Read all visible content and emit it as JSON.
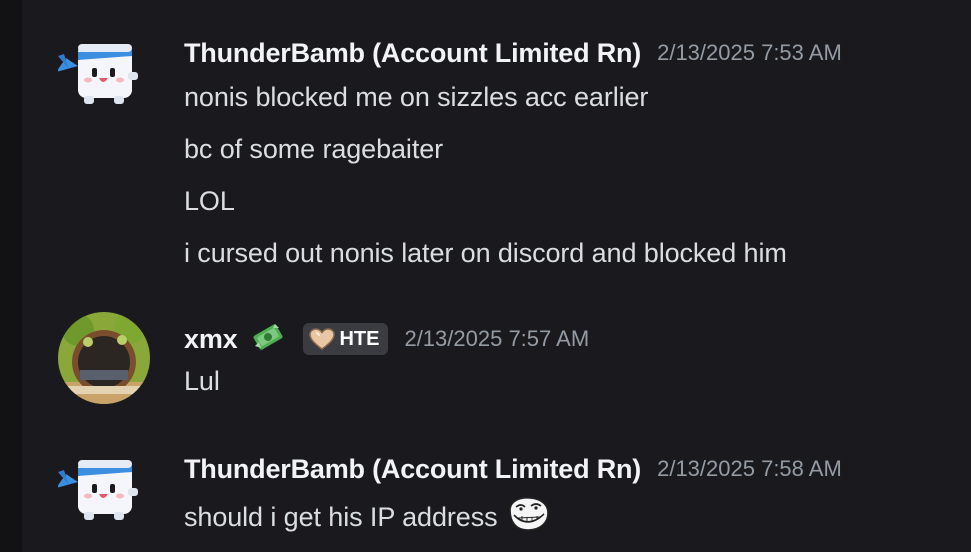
{
  "colors": {
    "background": "#1a1a1e",
    "username": "#f2f3f5",
    "timestamp": "#949ba4",
    "message_text": "#dbdee1",
    "badge_bg": "#3a3c42"
  },
  "messages": [
    {
      "author": "ThunderBamb (Account Limited Rn)",
      "timestamp": "2/13/2025 7:53 AM",
      "avatar_icon": "cube-headband-avatar-icon",
      "lines": [
        "nonis blocked me on sizzles acc earlier",
        "bc of some ragebaiter",
        "LOL",
        "i cursed out nonis later on discord and blocked him"
      ]
    },
    {
      "author": "xmx",
      "author_emoji_icon": "money-cash-icon",
      "badge": {
        "icon": "heart-icon",
        "label": "HTE"
      },
      "timestamp": "2/13/2025 7:57 AM",
      "avatar_icon": "hobbit-door-avatar-icon",
      "lines": [
        "Lul"
      ]
    },
    {
      "author": "ThunderBamb (Account Limited Rn)",
      "timestamp": "2/13/2025 7:58 AM",
      "avatar_icon": "cube-headband-avatar-icon",
      "lines": [
        "should i get his IP address"
      ],
      "trailing_emoji_icon": "trollface-icon"
    }
  ]
}
